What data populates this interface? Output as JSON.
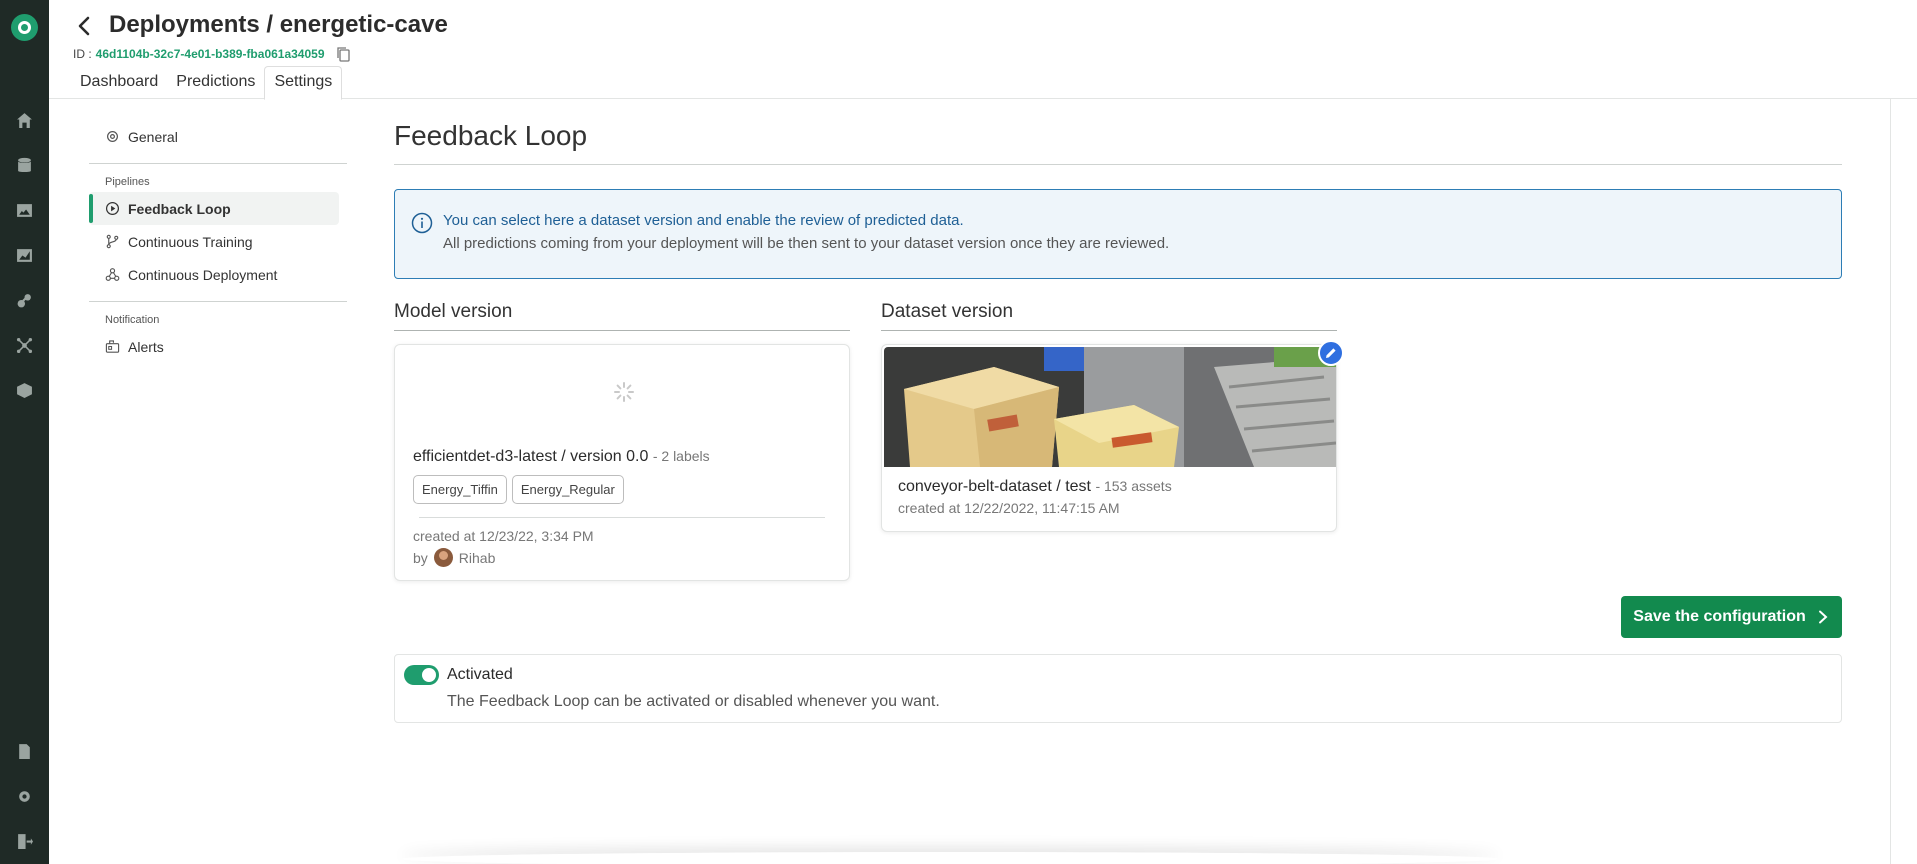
{
  "header": {
    "title": "Deployments / energetic-cave",
    "id_label": "ID :",
    "id_value": "46d1104b-32c7-4e01-b389-fba061a34059",
    "tabs": [
      {
        "label": "Dashboard"
      },
      {
        "label": "Predictions"
      },
      {
        "label": "Settings",
        "active": true
      }
    ]
  },
  "sidebar": {
    "general": "General",
    "pipelines_section": "Pipelines",
    "feedback_loop": "Feedback Loop",
    "continuous_training": "Continuous Training",
    "continuous_deployment": "Continuous Deployment",
    "notification_section": "Notification",
    "alerts": "Alerts"
  },
  "main": {
    "title": "Feedback Loop",
    "info_line1": "You can select here a dataset version and enable the review of predicted data.",
    "info_line2": "All predictions coming from your deployment will be then sent to your dataset version once they are reviewed.",
    "model_section": "Model version",
    "dataset_section": "Dataset version",
    "model": {
      "name": "efficientdet-d3-latest / version 0.0",
      "labels_count": "- 2 labels",
      "labels": [
        "Energy_Tiffin",
        "Energy_Regular"
      ],
      "created": "created at 12/23/22, 3:34 PM",
      "by": "by",
      "author": "Rihab"
    },
    "dataset": {
      "name": "conveyor-belt-dataset / test",
      "assets": "- 153 assets",
      "created": "created at 12/22/2022, 11:47:15 AM"
    },
    "save_button": "Save the configuration",
    "activation": {
      "label": "Activated",
      "description": "The Feedback Loop can be activated or disabled whenever you want.",
      "enabled": true
    }
  },
  "colors": {
    "accent": "#1f9d6e",
    "button": "#128a4e",
    "info_border": "#2d7db5",
    "rail": "#1f2a26"
  }
}
